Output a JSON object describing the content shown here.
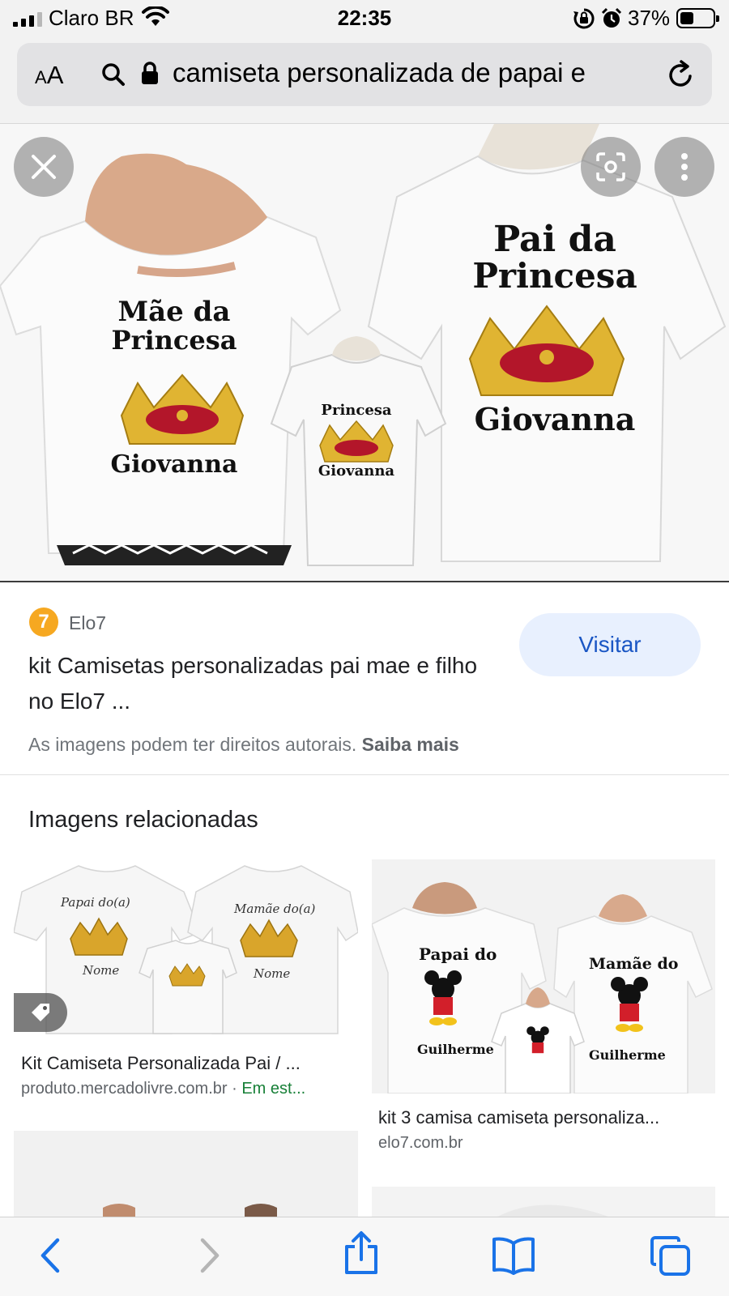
{
  "status_bar": {
    "carrier": "Claro BR",
    "time": "22:35",
    "battery_percent": "37%",
    "battery_level": 0.37,
    "icons": [
      "signal-icon",
      "wifi-icon",
      "rotation-lock-icon",
      "alarm-icon",
      "battery-icon"
    ]
  },
  "address_bar": {
    "text_size_small": "A",
    "text_size_large": "A",
    "url_text": "camiseta personalizada de papai e",
    "icons": [
      "search-icon",
      "lock-icon",
      "reload-icon"
    ]
  },
  "viewer": {
    "image": {
      "left_shirt": [
        "Mãe da",
        "Princesa",
        "Giovanna"
      ],
      "middle_shirt": [
        "Princesa",
        "Giovanna"
      ],
      "right_shirt": [
        "Pai da",
        "Princesa",
        "Giovanna"
      ]
    },
    "icons": [
      "close-icon",
      "google-lens-icon",
      "more-vertical-icon"
    ]
  },
  "result": {
    "source_icon_text": "7",
    "source_name": "Elo7",
    "title": "kit Camisetas personalizadas pai mae e filho no Elo7 ...",
    "visit_label": "Visitar",
    "copyright_text": "As imagens podem ter direitos autorais.",
    "learn_more": "Saiba mais"
  },
  "related": {
    "heading": "Imagens relacionadas",
    "items": [
      {
        "title": "Kit Camiseta Personalizada Pai / ...",
        "domain": "produto.mercadolivre.com.br · ",
        "stock": "Em est...",
        "image_text": {
          "left": "Papai do(a)",
          "right": "Mamãe do(a)",
          "name": "Nome"
        }
      },
      {
        "title": "kit 3 camisa camiseta personaliza...",
        "domain": "elo7.com.br",
        "stock": "",
        "image_text": {
          "left": "Papai do",
          "right": "Mamãe do",
          "name": "Guilherme"
        }
      }
    ]
  },
  "toolbar": {
    "icons": [
      "back-icon",
      "forward-icon",
      "share-icon",
      "bookmarks-icon",
      "tabs-icon"
    ]
  }
}
